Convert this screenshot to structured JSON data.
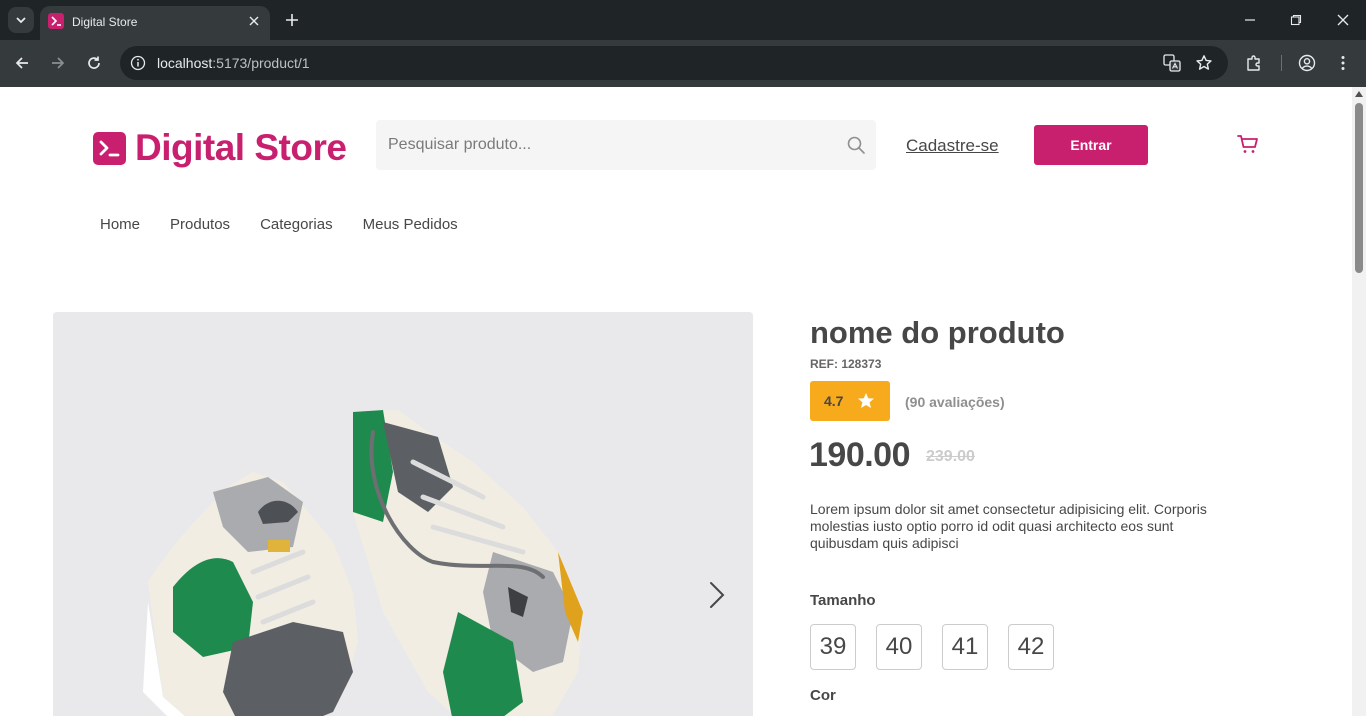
{
  "browser": {
    "tab_title": "Digital Store",
    "url_host": "localhost",
    "url_path": ":5173/product/1"
  },
  "header": {
    "logo_text": "Digital Store",
    "search_placeholder": "Pesquisar produto...",
    "signup_label": "Cadastre-se",
    "login_label": "Entrar"
  },
  "nav": {
    "items": [
      {
        "label": "Home"
      },
      {
        "label": "Produtos"
      },
      {
        "label": "Categorias"
      },
      {
        "label": "Meus Pedidos"
      }
    ]
  },
  "product": {
    "title": "nome do produto",
    "ref": "REF: 128373",
    "rating": "4.7",
    "reviews": "(90 avaliações)",
    "price": "190.00",
    "old_price": "239.00",
    "description": "Lorem ipsum dolor sit amet consectetur adipisicing elit. Corporis molestias iusto optio porro id odit quasi architecto eos sunt quibusdam quis adipisci",
    "size_label": "Tamanho",
    "sizes": [
      "39",
      "40",
      "41",
      "42"
    ],
    "color_label": "Cor"
  },
  "colors": {
    "brand": "#c91f6f",
    "rating": "#f6aa1c",
    "text": "#474747"
  }
}
